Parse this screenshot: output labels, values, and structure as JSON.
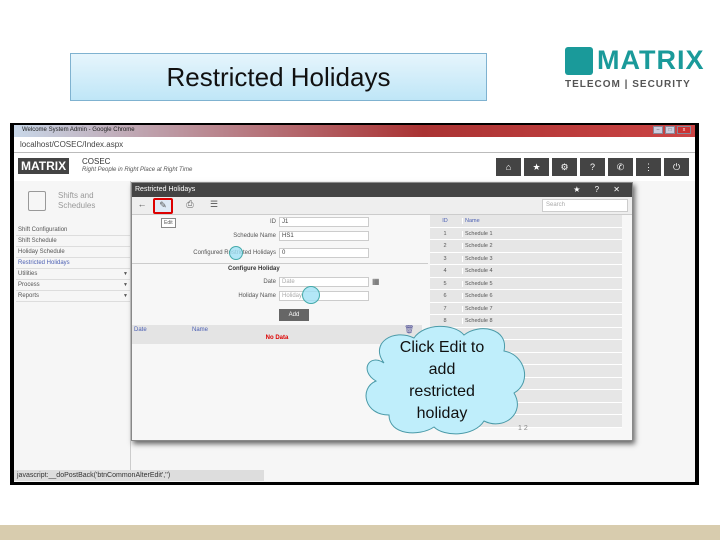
{
  "slide": {
    "title": "Restricted Holidays",
    "logo_text": "MATRIX",
    "logo_sub": "TELECOM | SECURITY"
  },
  "browser": {
    "window_title": "Welcome System Admin - Google Chrome",
    "url": "localhost/COSEC/Index.aspx"
  },
  "app": {
    "logo": "MATRIX",
    "product": "COSEC",
    "tagline": "Right People in Right Place at Right Time",
    "top_buttons": [
      "home-icon",
      "star-icon",
      "gear-icon",
      "help-icon",
      "phone-icon",
      "org-icon",
      "power-icon"
    ],
    "top_glyphs": [
      "⌂",
      "★",
      "⚙",
      "?",
      "✆",
      "⋮",
      "⏻"
    ]
  },
  "sidebar": {
    "heading": "Shifts and Schedules",
    "items": [
      {
        "label": "Shift Configuration"
      },
      {
        "label": "Shift Schedule"
      },
      {
        "label": "Holiday Schedule"
      },
      {
        "label": "Restricted Holidays",
        "active": true
      },
      {
        "label": "Utilities",
        "arrow": "▼"
      },
      {
        "label": "Process",
        "arrow": "▼"
      },
      {
        "label": "Reports",
        "arrow": "▼"
      }
    ]
  },
  "dialog": {
    "title": "Restricted Holidays",
    "header_icons": "★ ? ✕",
    "tooltip": "Edit",
    "search_placeholder": "Search",
    "fields": {
      "id_label": "ID",
      "id_value": "J1",
      "schedule_name_label": "Schedule Name",
      "schedule_name_value": "HS1",
      "configured_label": "Configured Restricted Holidays",
      "configured_value": "0",
      "section": "Configure Holiday",
      "date_label": "Date",
      "date_placeholder": "Date",
      "holiday_name_label": "Holiday Name",
      "holiday_name_placeholder": "Holiday"
    },
    "add_label": "Add",
    "list": {
      "columns": [
        "Date",
        "Name"
      ],
      "empty": "No Data"
    },
    "grid": {
      "columns": [
        "ID",
        "Name"
      ],
      "rows": [
        {
          "id": "1",
          "name": "Schedule 1"
        },
        {
          "id": "2",
          "name": "Schedule 2"
        },
        {
          "id": "3",
          "name": "Schedule 3"
        },
        {
          "id": "4",
          "name": "Schedule 4"
        },
        {
          "id": "5",
          "name": "Schedule 5"
        },
        {
          "id": "6",
          "name": "Schedule 6"
        },
        {
          "id": "7",
          "name": "Schedule 7"
        },
        {
          "id": "8",
          "name": "Schedule 8"
        }
      ],
      "pager": "1  2"
    }
  },
  "callout": {
    "text_lines": [
      "Click Edit to",
      "add",
      "restricted",
      "holiday"
    ]
  },
  "status_bar": "javascript:__doPostBack('btnCommonAlterEdit','')"
}
